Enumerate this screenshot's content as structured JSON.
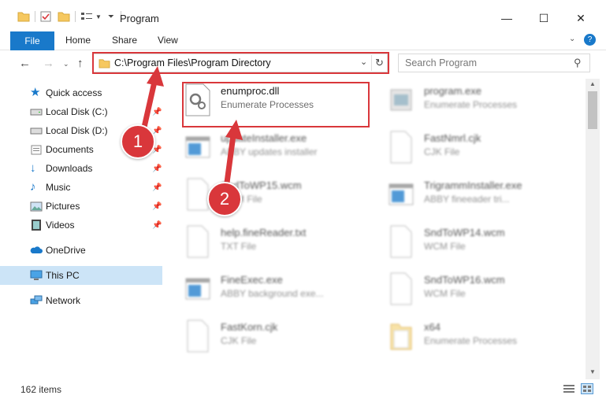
{
  "window": {
    "title": "Program",
    "minimize_glyph": "—",
    "maximize_glyph": "☐",
    "close_glyph": "✕"
  },
  "ribbon": {
    "tabs": [
      "File",
      "Home",
      "Share",
      "View"
    ]
  },
  "address": {
    "path": "C:\\Program Files\\Program Directory",
    "search_placeholder": "Search Program"
  },
  "sidebar": {
    "items": [
      {
        "label": "Quick access",
        "icon": "star-icon",
        "pinned": false
      },
      {
        "label": "Local Disk (C:)",
        "icon": "drive-icon",
        "pinned": true
      },
      {
        "label": "Local Disk (D:)",
        "icon": "drive-icon",
        "pinned": true
      },
      {
        "label": "Documents",
        "icon": "documents-icon",
        "pinned": true
      },
      {
        "label": "Downloads",
        "icon": "download-icon",
        "pinned": true
      },
      {
        "label": "Music",
        "icon": "music-icon",
        "pinned": true
      },
      {
        "label": "Pictures",
        "icon": "pictures-icon",
        "pinned": true
      },
      {
        "label": "Videos",
        "icon": "videos-icon",
        "pinned": true
      },
      {
        "label": "OneDrive",
        "icon": "cloud-icon",
        "pinned": false
      },
      {
        "label": "This PC",
        "icon": "monitor-icon",
        "pinned": false,
        "selected": true
      },
      {
        "label": "Network",
        "icon": "network-icon",
        "pinned": false
      }
    ]
  },
  "files": [
    {
      "name": "enumproc.dll",
      "desc": "Enumerate Processes",
      "icon": "dll-gear-icon",
      "highlighted": true
    },
    {
      "name": "program.exe",
      "desc": "Enumerate Processes",
      "icon": "exe-icon"
    },
    {
      "name": "updateInstaller.exe",
      "desc": "ABBY updates installer",
      "icon": "window-icon"
    },
    {
      "name": "FastNmrl.cjk",
      "desc": "CJK File",
      "icon": "blank-file-icon"
    },
    {
      "name": "SndToWP15.wcm",
      "desc": "WCM File",
      "icon": "blank-file-icon"
    },
    {
      "name": "TrigrammInstaller.exe",
      "desc": "ABBY fineeader tri...",
      "icon": "window-icon"
    },
    {
      "name": "help.fineReader.txt",
      "desc": "TXT File",
      "icon": "blank-file-icon"
    },
    {
      "name": "SndToWP14.wcm",
      "desc": "WCM File",
      "icon": "blank-file-icon"
    },
    {
      "name": "FineExec.exe",
      "desc": "ABBY background exe...",
      "icon": "window-icon"
    },
    {
      "name": "SndToWP16.wcm",
      "desc": "WCM File",
      "icon": "blank-file-icon"
    },
    {
      "name": "FastKorn.cjk",
      "desc": "CJK File",
      "icon": "blank-file-icon"
    },
    {
      "name": "x64",
      "desc": "Enumerate Processes",
      "icon": "folder-icon"
    }
  ],
  "status": {
    "count": "162 items"
  },
  "callouts": [
    "1",
    "2"
  ],
  "colors": {
    "accent": "#1979ca",
    "highlight": "#d9373b",
    "selection": "#cce4f7"
  }
}
